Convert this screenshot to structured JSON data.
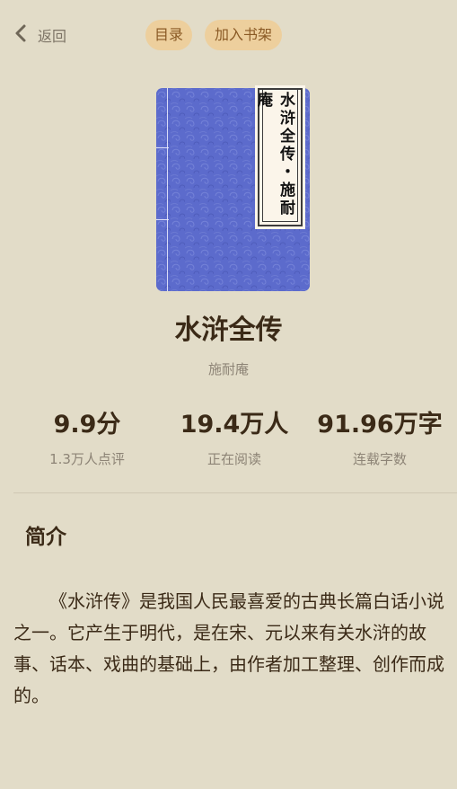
{
  "header": {
    "back_label": "返回",
    "toc_label": "目录",
    "add_shelf_label": "加入书架"
  },
  "book": {
    "cover_label": "水浒全传・施耐庵",
    "cover_color": "#5c6bcc",
    "title": "水浒全传",
    "author": "施耐庵"
  },
  "stats": [
    {
      "value": "9.9分",
      "label": "1.3万人点评"
    },
    {
      "value": "19.4万人",
      "label": "正在阅读"
    },
    {
      "value": "91.96万字",
      "label": "连载字数"
    }
  ],
  "intro": {
    "heading": "简介",
    "text": "《水浒传》是我国人民最喜爱的古典长篇白话小说之一。它产生于明代，是在宋、元以来有关水浒的故事、话本、戏曲的基础上，由作者加工整理、创作而成的。"
  },
  "colors": {
    "background": "#e2dcc8",
    "pill": "#edcf9d",
    "title_text": "#3b2a17"
  }
}
